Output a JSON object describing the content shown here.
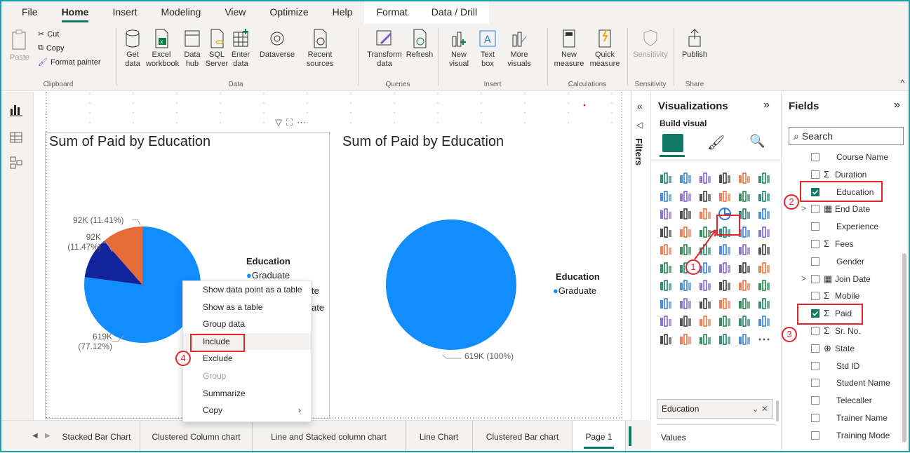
{
  "menu": [
    "File",
    "Home",
    "Insert",
    "Modeling",
    "View",
    "Optimize",
    "Help",
    "Format",
    "Data / Drill"
  ],
  "ribbon": {
    "clipboard": {
      "paste": "Paste",
      "cut": "Cut",
      "copy": "Copy",
      "format_painter": "Format painter",
      "label": "Clipboard"
    },
    "data": {
      "get_data": "Get\ndata",
      "excel": "Excel\nworkbook",
      "data_hub": "Data\nhub",
      "sql": "SQL\nServer",
      "enter": "Enter\ndata",
      "dataverse": "Dataverse",
      "recent": "Recent\nsources",
      "label": "Data"
    },
    "queries": {
      "transform": "Transform\ndata",
      "refresh": "Refresh",
      "label": "Queries"
    },
    "insert": {
      "new_visual": "New\nvisual",
      "text_box": "Text\nbox",
      "more_visuals": "More\nvisuals",
      "label": "Insert"
    },
    "calculations": {
      "new_measure": "New\nmeasure",
      "quick_measure": "Quick\nmeasure",
      "label": "Calculations"
    },
    "sensitivity": {
      "btn": "Sensitivity",
      "label": "Sensitivity"
    },
    "share": {
      "publish": "Publish",
      "label": "Share"
    }
  },
  "canvas": {
    "visual1": {
      "title": "Sum of Paid by Education",
      "legend_title": "Education",
      "legend_item": "Graduate",
      "legend_item_tail1": "te",
      "legend_item_tail2": "ate",
      "labels": [
        "92K (11.41%)",
        "92K\n(11.47%)",
        "619K\n(77.12%)"
      ]
    },
    "visual2": {
      "title": "Sum of Paid by Education",
      "legend_title": "Education",
      "legend_item": "Graduate",
      "label": "619K (100%)"
    },
    "context_menu": [
      "Show data point as a table",
      "Show as a table",
      "Group data",
      "Include",
      "Exclude",
      "Group",
      "Summarize",
      "Copy"
    ]
  },
  "chart_data": [
    {
      "type": "pie",
      "title": "Sum of Paid by Education",
      "slices": [
        {
          "value": 619,
          "percent": 77.12,
          "color": "#118dff"
        },
        {
          "value": 92,
          "percent": 11.47,
          "color": "#12239e"
        },
        {
          "value": 92,
          "percent": 11.41,
          "color": "#e66c37"
        }
      ],
      "legend": [
        "Graduate"
      ],
      "legend_title": "Education"
    },
    {
      "type": "pie",
      "title": "Sum of Paid by Education",
      "slices": [
        {
          "value": 619,
          "percent": 100,
          "color": "#118dff"
        }
      ],
      "legend": [
        "Graduate"
      ],
      "legend_title": "Education"
    }
  ],
  "tabs": [
    "Stacked Bar Chart",
    "Clustered Column chart",
    "Line and Stacked column chart",
    "Line Chart",
    "Clustered Bar chart",
    "Page 1"
  ],
  "add_tab": "+",
  "filters_label": "Filters",
  "viz": {
    "title": "Visualizations",
    "build_visual": "Build visual",
    "well_field": "Education",
    "values_label": "Values"
  },
  "fields": {
    "title": "Fields",
    "search_placeholder": "Search",
    "items": [
      {
        "name": "Course Name",
        "sigma": false,
        "checked": false,
        "expand": false,
        "table": false,
        "globe": false
      },
      {
        "name": "Duration",
        "sigma": true,
        "checked": false,
        "expand": false,
        "table": false,
        "globe": false
      },
      {
        "name": "Education",
        "sigma": false,
        "checked": true,
        "expand": false,
        "table": false,
        "globe": false
      },
      {
        "name": "End Date",
        "sigma": false,
        "checked": false,
        "expand": true,
        "table": true,
        "globe": false
      },
      {
        "name": "Experience",
        "sigma": false,
        "checked": false,
        "expand": false,
        "table": false,
        "globe": false
      },
      {
        "name": "Fees",
        "sigma": true,
        "checked": false,
        "expand": false,
        "table": false,
        "globe": false
      },
      {
        "name": "Gender",
        "sigma": false,
        "checked": false,
        "expand": false,
        "table": false,
        "globe": false
      },
      {
        "name": "Join Date",
        "sigma": false,
        "checked": false,
        "expand": true,
        "table": true,
        "globe": false
      },
      {
        "name": "Mobile",
        "sigma": true,
        "checked": false,
        "expand": false,
        "table": false,
        "globe": false
      },
      {
        "name": "Paid",
        "sigma": true,
        "checked": true,
        "expand": false,
        "table": false,
        "globe": false
      },
      {
        "name": "Sr. No.",
        "sigma": true,
        "checked": false,
        "expand": false,
        "table": false,
        "globe": false
      },
      {
        "name": "State",
        "sigma": false,
        "checked": false,
        "expand": false,
        "table": false,
        "globe": true
      },
      {
        "name": "Std ID",
        "sigma": false,
        "checked": false,
        "expand": false,
        "table": false,
        "globe": false
      },
      {
        "name": "Student Name",
        "sigma": false,
        "checked": false,
        "expand": false,
        "table": false,
        "globe": false
      },
      {
        "name": "Telecaller",
        "sigma": false,
        "checked": false,
        "expand": false,
        "table": false,
        "globe": false
      },
      {
        "name": "Trainer Name",
        "sigma": false,
        "checked": false,
        "expand": false,
        "table": false,
        "globe": false
      },
      {
        "name": "Training Mode",
        "sigma": false,
        "checked": false,
        "expand": false,
        "table": false,
        "globe": false
      }
    ]
  },
  "annotations": [
    "1",
    "2",
    "3",
    "4"
  ],
  "colors": {
    "accent": "#117865",
    "annotation": "#e3252b",
    "pie_blue": "#118dff",
    "pie_navy": "#12239e",
    "pie_orange": "#e66c37"
  }
}
